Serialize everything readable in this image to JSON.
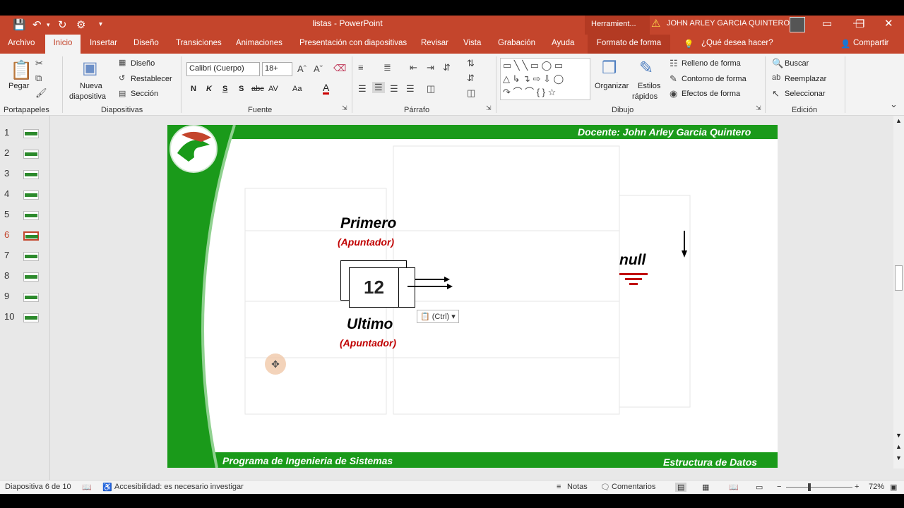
{
  "titlebar": {
    "title": "listas  -  PowerPoint",
    "context": "Herramient...",
    "user": "JOHN ARLEY GARCIA QUINTERO"
  },
  "tabs": [
    "Archivo",
    "Inicio",
    "Insertar",
    "Diseño",
    "Transiciones",
    "Animaciones",
    "Presentación con diapositivas",
    "Revisar",
    "Vista",
    "Grabación",
    "Ayuda",
    "Formato de forma",
    "¿Qué desea hacer?",
    "Compartir"
  ],
  "ribbon": {
    "portapapeles": {
      "pegar": "Pegar",
      "label": "Portapapeles"
    },
    "diapositivas": {
      "nueva": "Nueva",
      "diapositiva": "diapositiva",
      "diseno": "Diseño",
      "restablecer": "Restablecer",
      "seccion": "Sección",
      "label": "Diapositivas"
    },
    "fuente": {
      "font": "Calibri (Cuerpo)",
      "size": "18+",
      "n": "N",
      "k": "K",
      "s": "S",
      "sh": "S",
      "abc": "abc",
      "av": "AV",
      "aa": "Aa",
      "a": "A",
      "label": "Fuente"
    },
    "parrafo": {
      "label": "Párrafo"
    },
    "dibujo": {
      "organizar": "Organizar",
      "estilos": "Estilos",
      "rapidos": "rápidos",
      "relleno": "Relleno de forma",
      "contorno": "Contorno de forma",
      "efectos": "Efectos de forma",
      "label": "Dibujo"
    },
    "edicion": {
      "buscar": "Buscar",
      "reemplazar": "Reemplazar",
      "seleccionar": "Seleccionar",
      "label": "Edición"
    }
  },
  "thumbs": [
    "1",
    "2",
    "3",
    "4",
    "5",
    "6",
    "7",
    "8",
    "9",
    "10"
  ],
  "slide": {
    "header": "Docente: John Arley Garcia  Quintero",
    "footer_left": "Programa de Ingenieria de Sistemas",
    "footer_right": "Estructura de Datos",
    "primero": "Primero",
    "apuntador1": "(Apuntador)",
    "node_value": "12",
    "ultimo": "Ultimo",
    "apuntador2": "(Apuntador)",
    "null": "null",
    "paste": "(Ctrl)"
  },
  "status": {
    "slide": "Diapositiva 6 de 10",
    "access": "Accesibilidad: es necesario investigar",
    "notas": "Notas",
    "comentarios": "Comentarios",
    "zoom": "72%"
  }
}
